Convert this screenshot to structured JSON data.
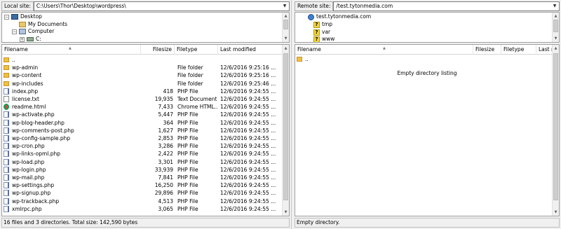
{
  "local": {
    "site_label": "Local site:",
    "path": "C:\\Users\\Thor\\Desktop\\wordpress\\",
    "tree": [
      {
        "label": "Desktop",
        "icon": "desktop-icon",
        "expander": "−"
      },
      {
        "label": "My Documents",
        "icon": "documents-icon",
        "expander": ""
      },
      {
        "label": "Computer",
        "icon": "computer-icon",
        "expander": "−"
      },
      {
        "label": "C:",
        "icon": "drive-icon",
        "expander": "+"
      }
    ],
    "columns": [
      "Filename",
      "Filesize",
      "Filetype",
      "Last modified"
    ],
    "files": [
      {
        "name": "..",
        "size": "",
        "type": "",
        "modified": "",
        "icon": "folder"
      },
      {
        "name": "wp-admin",
        "size": "",
        "type": "File folder",
        "modified": "12/6/2016 9:25:16 ...",
        "icon": "folder"
      },
      {
        "name": "wp-content",
        "size": "",
        "type": "File folder",
        "modified": "12/6/2016 9:25:16 ...",
        "icon": "folder"
      },
      {
        "name": "wp-includes",
        "size": "",
        "type": "File folder",
        "modified": "12/6/2016 9:25:46 ...",
        "icon": "folder"
      },
      {
        "name": "index.php",
        "size": "418",
        "type": "PHP File",
        "modified": "12/6/2016 9:24:55 ...",
        "icon": "php"
      },
      {
        "name": "license.txt",
        "size": "19,935",
        "type": "Text Document",
        "modified": "12/6/2016 9:24:55 ...",
        "icon": "txt"
      },
      {
        "name": "readme.html",
        "size": "7,433",
        "type": "Chrome HTML...",
        "modified": "12/6/2016 9:24:55 ...",
        "icon": "chrome"
      },
      {
        "name": "wp-activate.php",
        "size": "5,447",
        "type": "PHP File",
        "modified": "12/6/2016 9:24:55 ...",
        "icon": "php"
      },
      {
        "name": "wp-blog-header.php",
        "size": "364",
        "type": "PHP File",
        "modified": "12/6/2016 9:24:55 ...",
        "icon": "php"
      },
      {
        "name": "wp-comments-post.php",
        "size": "1,627",
        "type": "PHP File",
        "modified": "12/6/2016 9:24:55 ...",
        "icon": "php"
      },
      {
        "name": "wp-config-sample.php",
        "size": "2,853",
        "type": "PHP File",
        "modified": "12/6/2016 9:24:55 ...",
        "icon": "php"
      },
      {
        "name": "wp-cron.php",
        "size": "3,286",
        "type": "PHP File",
        "modified": "12/6/2016 9:24:55 ...",
        "icon": "php"
      },
      {
        "name": "wp-links-opml.php",
        "size": "2,422",
        "type": "PHP File",
        "modified": "12/6/2016 9:24:55 ...",
        "icon": "php"
      },
      {
        "name": "wp-load.php",
        "size": "3,301",
        "type": "PHP File",
        "modified": "12/6/2016 9:24:55 ...",
        "icon": "php"
      },
      {
        "name": "wp-login.php",
        "size": "33,939",
        "type": "PHP File",
        "modified": "12/6/2016 9:24:55 ...",
        "icon": "php"
      },
      {
        "name": "wp-mail.php",
        "size": "7,841",
        "type": "PHP File",
        "modified": "12/6/2016 9:24:55 ...",
        "icon": "php"
      },
      {
        "name": "wp-settings.php",
        "size": "16,250",
        "type": "PHP File",
        "modified": "12/6/2016 9:24:55 ...",
        "icon": "php"
      },
      {
        "name": "wp-signup.php",
        "size": "29,896",
        "type": "PHP File",
        "modified": "12/6/2016 9:24:55 ...",
        "icon": "php"
      },
      {
        "name": "wp-trackback.php",
        "size": "4,513",
        "type": "PHP File",
        "modified": "12/6/2016 9:24:55 ...",
        "icon": "php"
      },
      {
        "name": "xmlrpc.php",
        "size": "3,065",
        "type": "PHP File",
        "modified": "12/6/2016 9:24:55 ...",
        "icon": "php"
      }
    ],
    "status": "16 files and 3 directories. Total size: 142,590 bytes"
  },
  "remote": {
    "site_label": "Remote site:",
    "path": "/test.tytonmedia.com",
    "tree": [
      {
        "label": "test.tytonmedia.com",
        "icon": "server-folder-icon"
      },
      {
        "label": "tmp",
        "icon": "unknown-folder-icon"
      },
      {
        "label": "var",
        "icon": "unknown-folder-icon"
      },
      {
        "label": "www",
        "icon": "unknown-folder-icon"
      }
    ],
    "columns": [
      "Filename",
      "Filesize",
      "Filetype",
      "Last modified"
    ],
    "files": [
      {
        "name": "..",
        "icon": "folder"
      }
    ],
    "empty_message": "Empty directory listing",
    "status": "Empty directory."
  }
}
